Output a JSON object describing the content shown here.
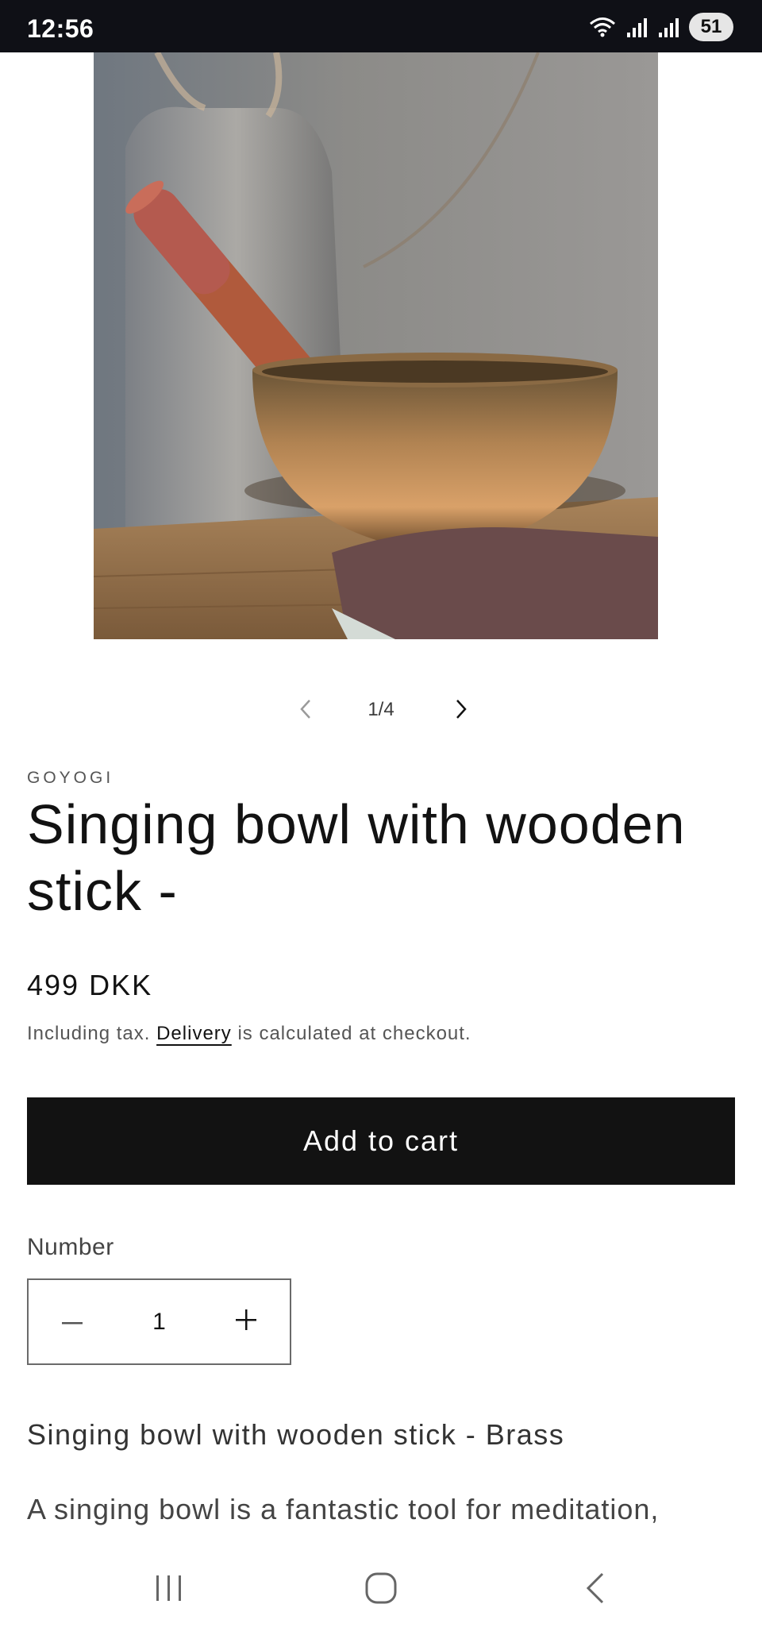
{
  "status_bar": {
    "time": "12:56",
    "battery": "51"
  },
  "slider": {
    "counter": "1/4"
  },
  "product": {
    "vendor": "GOYOGI",
    "title": "Singing bowl with wooden stick -",
    "price": "499 DKK",
    "tax_prefix": "Including tax.",
    "delivery_link": "Delivery",
    "tax_suffix": "is calculated at checkout."
  },
  "cart": {
    "add_to_cart_label": "Add to cart"
  },
  "quantity": {
    "label": "Number",
    "value": "1"
  },
  "description": {
    "heading": "Singing bowl with wooden stick - Brass",
    "text": "A singing bowl is a fantastic tool for meditation,"
  },
  "icons": {
    "wifi": "wifi-icon",
    "signal": "signal-icon",
    "prev": "chevron-left-icon",
    "next": "chevron-right-icon",
    "minus": "minus-icon",
    "plus": "plus-icon",
    "recents": "recents-icon",
    "home": "home-icon",
    "back": "back-icon"
  },
  "colors": {
    "accent": "#121212",
    "status_bar": "#0f1016",
    "background": "#ffffff"
  }
}
